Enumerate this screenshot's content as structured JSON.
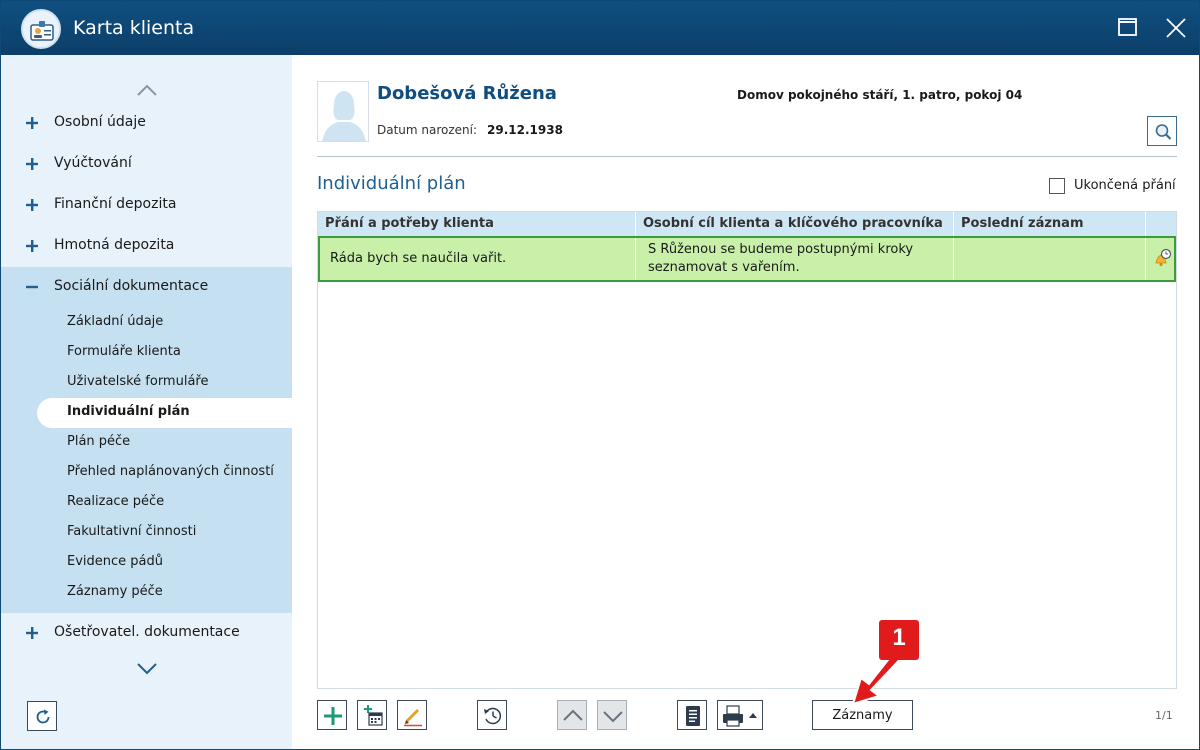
{
  "window": {
    "title": "Karta klienta"
  },
  "sidebar": {
    "top_items": [
      {
        "label": "Osobní údaje"
      },
      {
        "label": "Vyúčtování"
      },
      {
        "label": "Finanční depozita"
      },
      {
        "label": "Hmotná depozita"
      },
      {
        "label": "Sociální dokumentace"
      }
    ],
    "sub_items": [
      {
        "label": "Základní údaje"
      },
      {
        "label": "Formuláře klienta"
      },
      {
        "label": "Uživatelské formuláře"
      },
      {
        "label": "Individuální plán"
      },
      {
        "label": "Plán péče"
      },
      {
        "label": "Přehled naplánovaných činností"
      },
      {
        "label": "Realizace péče"
      },
      {
        "label": "Fakultativní činnosti"
      },
      {
        "label": "Evidence pádů"
      },
      {
        "label": "Záznamy péče"
      }
    ],
    "bottom_item": {
      "label": "Ošetřovatel. dokumentace"
    }
  },
  "client": {
    "name": "Dobešová Růžena",
    "birth_label": "Datum narození:",
    "birth_date": "29.12.1938",
    "location": "Domov pokojného stáří, 1. patro, pokoj 04"
  },
  "plan": {
    "title": "Individuální plán",
    "ended_label": "Ukončená přání",
    "columns": [
      "Přání a potřeby klienta",
      "Osobní cíl klienta a klíčového pracovníka",
      "Poslední záznam"
    ],
    "rows": [
      {
        "wish": "Ráda bych se naučila vařit.",
        "goal_line1": "S Růženou se budeme postupnými kroky",
        "goal_line2": "seznamovat s vařením.",
        "last_record": ""
      }
    ]
  },
  "toolbar": {
    "records_label": "Záznamy",
    "page_count": "1/1"
  },
  "callout": {
    "number": "1"
  },
  "colors": {
    "titlebar": "#0f4f80",
    "sidebar": "#e8f2fa",
    "sidebar_open_section": "#c4e0f1",
    "table_header": "#cfe6f4",
    "row_selected": "#c8f0a8",
    "row_border": "#3d9a3d",
    "callout": "#e11b1b"
  }
}
